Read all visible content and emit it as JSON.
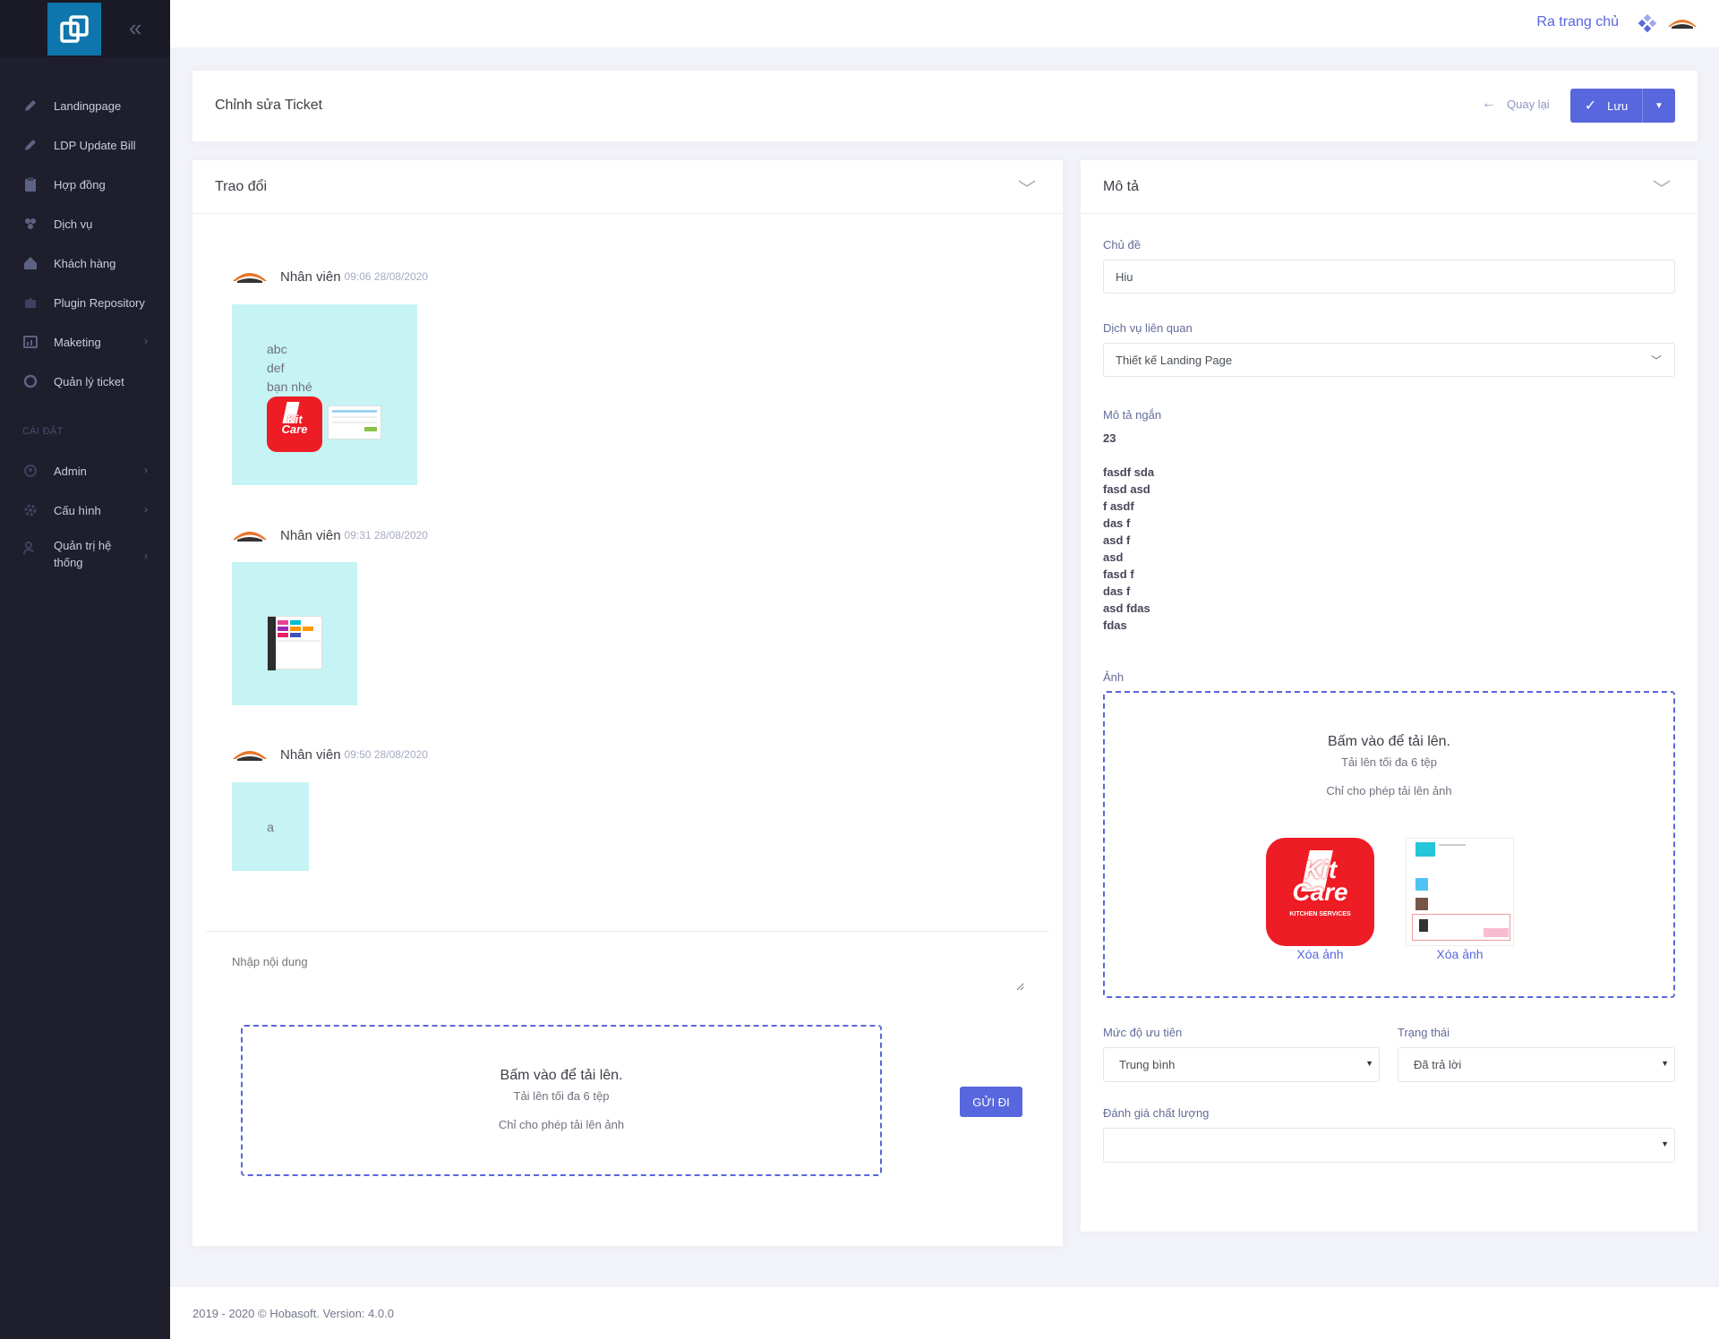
{
  "topbar": {
    "home_link": "Ra trang chủ",
    "apps_icon": "apps-icon",
    "avatar_icon": "user-avatar-icon"
  },
  "sidebar": {
    "items": [
      {
        "label": "Landingpage",
        "icon": "edit-icon"
      },
      {
        "label": "LDP Update Bill",
        "icon": "edit-icon"
      },
      {
        "label": "Hợp đồng",
        "icon": "clipboard-icon"
      },
      {
        "label": "Dịch vụ",
        "icon": "services-icon"
      },
      {
        "label": "Khách hàng",
        "icon": "home-icon"
      },
      {
        "label": "Plugin Repository",
        "icon": "puzzle-icon"
      },
      {
        "label": "Maketing",
        "icon": "chart-icon"
      },
      {
        "label": "Quản lý ticket",
        "icon": "support-icon"
      }
    ],
    "section_title": "CÀI ĐẶT",
    "settings": [
      {
        "label": "Admin",
        "icon": "shield-icon"
      },
      {
        "label": "Cấu hình",
        "icon": "gear-icon"
      },
      {
        "label": "Quản trị hệ thống",
        "icon": "user-settings-icon"
      }
    ]
  },
  "subheader": {
    "title": "Chỉnh sửa Ticket",
    "back_label": "Quay lại",
    "save_label": "Lưu"
  },
  "chat": {
    "title": "Trao đổi",
    "messages": [
      {
        "author": "Nhân viên",
        "time": "09:06 28/08/2020",
        "lines": [
          "abc",
          "def",
          "bạn nhé"
        ]
      },
      {
        "author": "Nhân viên",
        "time": "09:31 28/08/2020",
        "lines": []
      },
      {
        "author": "Nhân viên",
        "time": "09:50 28/08/2020",
        "lines": [
          "a"
        ]
      }
    ],
    "input_placeholder": "Nhập nội dung",
    "upload": {
      "title": "Bấm vào để tải lên.",
      "limit": "Tải lên tối đa 6 tệp",
      "note": "Chỉ cho phép tải lên ảnh"
    },
    "send_label": "GỬI ĐI"
  },
  "desc": {
    "title": "Mô tả",
    "subject_label": "Chủ đề",
    "subject_value": "Hiu",
    "service_label": "Dịch vụ liên quan",
    "service_value": "Thiết kế Landing Page",
    "short_label": "Mô tả ngắn",
    "short_first": "23",
    "short_lines": [
      "fasdf sda",
      "fasd asd",
      "f asdf",
      "das f",
      "asd f",
      "asd",
      "fasd f",
      "das f",
      "asd fdas",
      "fdas"
    ],
    "image_label": "Ảnh",
    "upload": {
      "title": "Bấm vào để tải lên.",
      "limit": "Tải lên tối đa 6 tệp",
      "note": "Chỉ cho phép tải lên ảnh"
    },
    "remove_label": "Xóa ảnh",
    "kit_logo": {
      "line1": "Kit",
      "line2": "Care",
      "tag": "KITCHEN SERVICES"
    },
    "priority_label": "Mức độ ưu tiên",
    "priority_value": "Trung bình",
    "status_label": "Trạng thái",
    "status_value": "Đã trả lời",
    "quality_label": "Đánh giá chất lượng",
    "quality_value": ""
  },
  "footer": {
    "text": "2019 - 2020 © Hobasoft. Version: 4.0.0"
  }
}
